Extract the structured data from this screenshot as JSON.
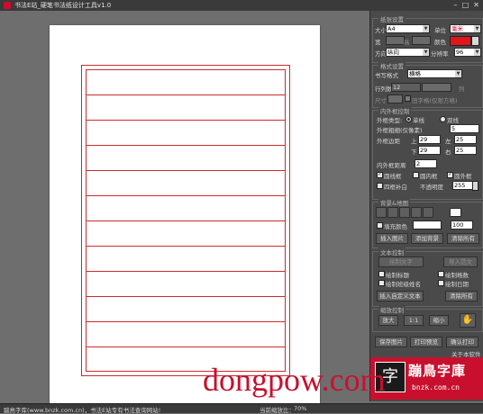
{
  "window": {
    "title": "书法E站_硬笔书法纸设计工具v1.0",
    "minimize": "–",
    "maximize": "□",
    "close": "✕"
  },
  "paper_settings": {
    "section_title": "纸张设置",
    "size_label": "大小",
    "size_value": "A4",
    "unit_label": "单位",
    "unit_value": "毫米",
    "width_label": "宽",
    "width_value": "",
    "height_label": "高",
    "color_label": "颜色",
    "color_value": "#e3141b",
    "direction_label": "方向",
    "direction_value": "纵向",
    "resolution_label": "分辨率",
    "resolution_value": "96"
  },
  "style_settings": {
    "section_title": "格式设置",
    "format_label": "书写格式",
    "format_value": "横格",
    "rows_cols_label": "行列数",
    "rows_value": "12",
    "cols_label": "列",
    "size_label": "尺寸",
    "square_label": "田字格(仅限方格)"
  },
  "frame_settings": {
    "section_title": "内外框控制",
    "frame_type_label": "外框类型:",
    "single_label": "单线",
    "double_label": "双线",
    "frame_thickness_label": "外框粗细(仅像素)",
    "frame_thickness_value": "5",
    "margin_label": "外框边距",
    "top_label": "上",
    "top_value": "29",
    "left_label": "左",
    "left_value": "25",
    "bottom_label": "下",
    "bottom_value": "29",
    "right_label": "右",
    "right_value": "25",
    "inner_spacing_label": "内外框距离",
    "inner_spacing_value": "2",
    "round_line_label": "圆线框",
    "round_inner_label": "圆内框",
    "round_outer_label": "圆外框",
    "fill_white_label": "四框补白",
    "opacity_label": "不透明度",
    "opacity_value": "255"
  },
  "background_settings": {
    "section_title": "背景&地图",
    "fill_color_label": "填充颜色",
    "fill_value": "100",
    "insert_image": "插入图片",
    "add_background": "添加背景",
    "clear_all": "清除所有"
  },
  "text_settings": {
    "section_title": "文本控制",
    "draw_text": "绘制文字",
    "import_text": "导入范文",
    "draw_title_label": "绘制标题",
    "draw_grid_count_label": "绘制格数",
    "draw_class_name_label": "绘制班级姓名",
    "draw_date_label": "绘制日期",
    "insert_custom_text": "插入自定义文本",
    "clear_all": "清除所有"
  },
  "zoom_settings": {
    "section_title": "缩放控制",
    "zoom_in": "放大",
    "one_to_one": "1:1",
    "zoom_out": "缩小"
  },
  "actions": {
    "save_image": "保存图片",
    "print_preview": "打印预览",
    "confirm_print": "确认打印",
    "about": "关于本软件"
  },
  "logo": {
    "name": "蹦鳥字庫",
    "site": "bnzk.com.cn"
  },
  "watermark": "dongpow.com",
  "status": {
    "left": "蹦鳥字库(www.bnzk.com.cn)，书法E站专有书法查询网站!",
    "zoom_label": "当前缩放比：",
    "zoom_value": "70%"
  },
  "colors": {
    "accent": "#c8102e",
    "grid_red": "#cc2b2b",
    "panel_bg": "#4a4a4a"
  }
}
